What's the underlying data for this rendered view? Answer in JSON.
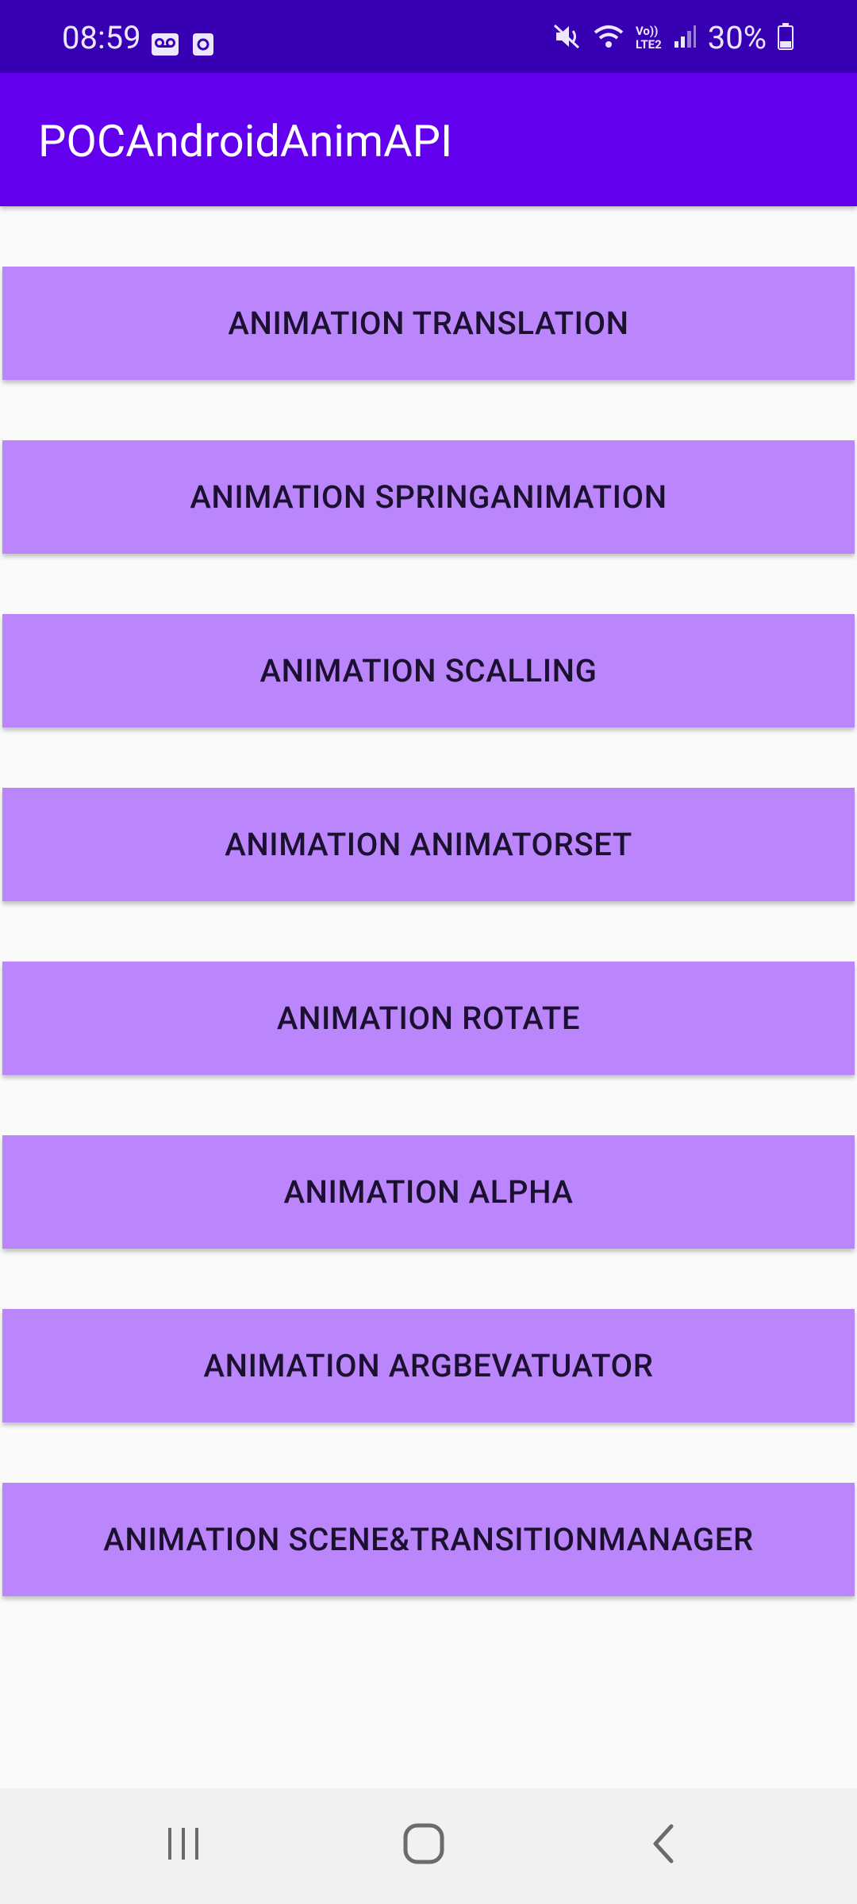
{
  "status_bar": {
    "time": "08:59",
    "battery": "30%",
    "icons_left": [
      "voicemail-icon",
      "notification-app-icon"
    ],
    "icons_right": [
      "mute-icon",
      "wifi-icon",
      "volte-lte2-icon",
      "signal-icon",
      "battery-icon"
    ],
    "volte_label": "Vo))",
    "lte_label": "LTE2"
  },
  "app_bar": {
    "title": "POCAndroidAnimAPI"
  },
  "buttons": [
    {
      "label": "ANIMATION TRANSLATION"
    },
    {
      "label": "ANIMATION SPRINGANIMATION"
    },
    {
      "label": "ANIMATION SCALLING"
    },
    {
      "label": "ANIMATION ANIMATORSET"
    },
    {
      "label": "ANIMATION ROTATE"
    },
    {
      "label": "ANIMATION ALPHA"
    },
    {
      "label": "ANIMATION ARGBEVATUATOR"
    },
    {
      "label": "ANIMATION SCENE&TRANSITIONMANAGER"
    }
  ],
  "colors": {
    "status_bar": "#3700b3",
    "app_bar": "#6200ee",
    "button": "#bb86fc",
    "background": "#fafafa",
    "nav_bar": "#f1f1f1"
  },
  "nav_bar": {
    "icons": [
      "recent-apps-icon",
      "home-icon",
      "back-icon"
    ]
  }
}
